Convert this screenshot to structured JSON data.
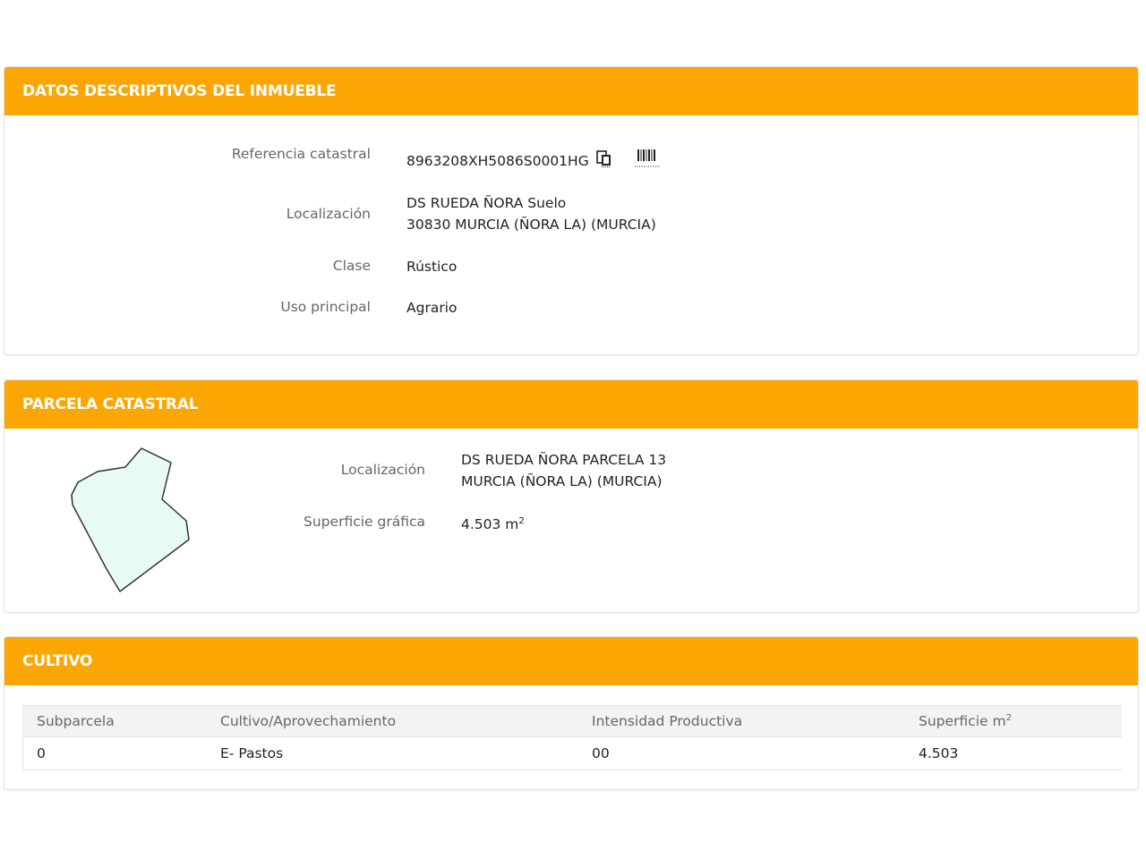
{
  "datos": {
    "title": "DATOS DESCRIPTIVOS DEL INMUEBLE",
    "referencia_label": "Referencia catastral",
    "referencia_value": "8963208XH5086S0001HG",
    "copy_icon": "copy-icon",
    "barcode_icon": "barcode-icon",
    "localizacion_label": "Localización",
    "localizacion_line1": "DS RUEDA ÑORA Suelo",
    "localizacion_line2": "30830 MURCIA (ÑORA LA) (MURCIA)",
    "clase_label": "Clase",
    "clase_value": "Rústico",
    "uso_label": "Uso principal",
    "uso_value": "Agrario"
  },
  "parcela": {
    "title": "PARCELA CATASTRAL",
    "localizacion_label": "Localización",
    "localizacion_line1": "DS RUEDA ÑORA PARCELA 13",
    "localizacion_line2": "MURCIA (ÑORA LA) (MURCIA)",
    "superficie_label": "Superficie gráfica",
    "superficie_value": "4.503 m",
    "superficie_sup": "2",
    "shape_fill": "#e8fbf3"
  },
  "cultivo": {
    "title": "CULTIVO",
    "headers": {
      "subparcela": "Subparcela",
      "cultivo": "Cultivo/Aprovechamiento",
      "intensidad": "Intensidad Productiva",
      "superficie": "Superficie m",
      "superficie_sup": "2"
    },
    "rows": [
      {
        "subparcela": "0",
        "cultivo": "E- Pastos",
        "intensidad": "00",
        "superficie": "4.503"
      }
    ]
  },
  "colors": {
    "header_bg": "#fca604",
    "header_text": "#ffffff"
  }
}
